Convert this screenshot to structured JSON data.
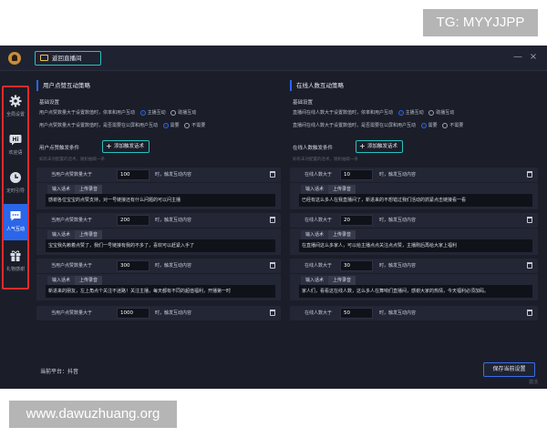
{
  "watermarks": {
    "top": "TG: MYYJJPP",
    "bottom": "www.dawuzhuang.org"
  },
  "titlebar": {
    "back_label": "返回直播间",
    "minimize": "—",
    "close": "×"
  },
  "sidebar": {
    "items": [
      {
        "label": "全局设置",
        "icon": "gear-icon",
        "active": false
      },
      {
        "label": "欢迎语",
        "icon": "hi-icon",
        "active": false
      },
      {
        "label": "定时引导",
        "icon": "clock-icon",
        "active": false
      },
      {
        "label": "人气互动",
        "icon": "chat-icon",
        "active": true
      },
      {
        "label": "礼物感谢",
        "icon": "gift-icon",
        "active": false
      }
    ]
  },
  "left": {
    "title": "用户点赞互动策略",
    "basic_title": "基础设置",
    "opt1": {
      "text": "用户点赞数量大于设置数值时，依率和用户互动",
      "a": "主播互动",
      "b": "助播互动"
    },
    "opt2": {
      "text": "用户点赞数量大于设置数值时，是否需要在公屏和用户互动",
      "a": "需要",
      "b": "不需要"
    },
    "cond_label": "用户点赞触发条件",
    "add_label": "添加触发话术",
    "hint": "如有未对配置的话术，随机抽取一条",
    "rules": [
      {
        "prefix": "当用户点赞数量大于",
        "value": "100",
        "suffix": "时，触发互动内容",
        "tab1": "输入话术",
        "tab2": "上传录音",
        "content": "感谢各位宝宝的点赞支持，对一号链接还有什么问题的可以问主播"
      },
      {
        "prefix": "当用户点赞数量大于",
        "value": "200",
        "suffix": "时，触发互动内容",
        "tab1": "输入话术",
        "tab2": "上传录音",
        "content": "宝宝我先赖着点赞了，我们一号链接有我的不多了，喜欢可以赶紧入手了"
      },
      {
        "prefix": "当用户点赞数量大于",
        "value": "300",
        "suffix": "时，触发互动内容",
        "tab1": "输入话术",
        "tab2": "上传录音",
        "content": "新进来的朋友，左上角点个关注不迷路！关注主播，每天都有不同的超值福利，开播第一时"
      },
      {
        "prefix": "当用户点赞数量大于",
        "value": "1000",
        "suffix": "时，触发互动内容"
      }
    ]
  },
  "right": {
    "title": "在线人数互动策略",
    "basic_title": "基础设置",
    "opt1": {
      "text": "直播间在线人数大于设置数值时，依率和用户互动",
      "a": "主播互动",
      "b": "助播互动"
    },
    "opt2": {
      "text": "直播间在线人数大于设置数值时，是否需要在公屏和用户互动",
      "a": "需要",
      "b": "不需要"
    },
    "cond_label": "在线人数触发条件",
    "add_label": "添加触发话术",
    "hint": "如有未对配置的话术，随机抽取一条",
    "rules": [
      {
        "prefix": "在线人数大于",
        "value": "10",
        "suffix": "时，触发互动内容",
        "tab1": "输入话术",
        "tab2": "上传录音",
        "content": "已经有这么多人在我直播间了，新进来的不想错过我们活动的抓紧点击链接看一看"
      },
      {
        "prefix": "在线人数大于",
        "value": "20",
        "suffix": "时，触发互动内容",
        "tab1": "输入话术",
        "tab2": "上传录音",
        "content": "在直播间这么多家人，可以给主播点点关注点点赞，主播刚后再给大家上福利"
      },
      {
        "prefix": "在线人数大于",
        "value": "30",
        "suffix": "时，触发互动内容",
        "tab1": "输入话术",
        "tab2": "上传录音",
        "content": "家人们，看看这在线人数，这么多人在舞响们直播间，感谢大家的热情，今天福利必须加码。"
      },
      {
        "prefix": "在线人数大于",
        "value": "50",
        "suffix": "时，触发互动内容"
      }
    ]
  },
  "footer": {
    "platform": "当前平台：抖音",
    "save": "保存当前设置",
    "corner": "激活"
  }
}
